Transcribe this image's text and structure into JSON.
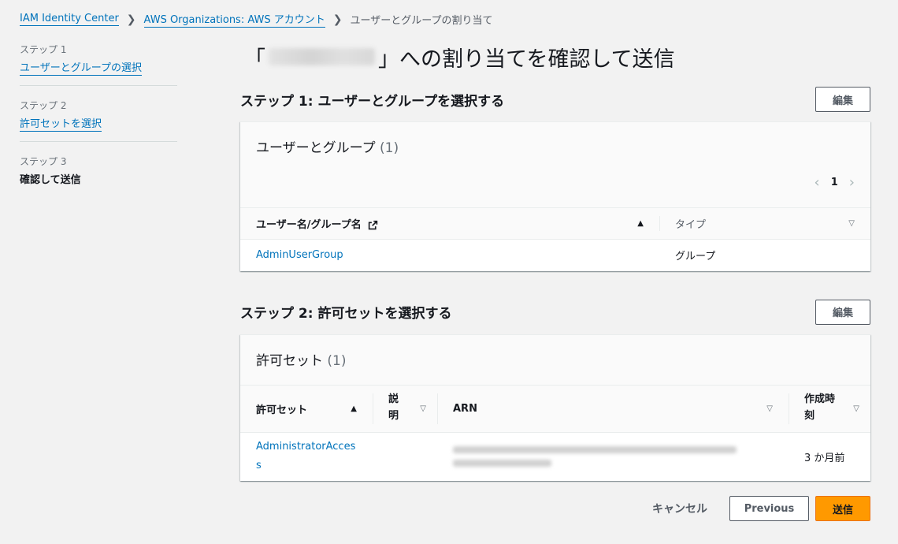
{
  "breadcrumb": {
    "items": [
      {
        "label": "IAM Identity Center",
        "link": true
      },
      {
        "label": "AWS Organizations: AWS アカウント",
        "link": true
      },
      {
        "label": "ユーザーとグループの割り当て",
        "link": false
      }
    ],
    "separator_icon": "chevron-right-icon"
  },
  "steps": [
    {
      "number": "ステップ 1",
      "label": "ユーザーとグループの選択",
      "link": true
    },
    {
      "number": "ステップ 2",
      "label": "許可セットを選択",
      "link": true
    },
    {
      "number": "ステップ 3",
      "label": "確認して送信",
      "link": false,
      "active": true
    }
  ],
  "page": {
    "title_open": "「",
    "title_account_redacted": "[redacted account name]",
    "title_close": "」への割り当てを確認して送信"
  },
  "section1": {
    "title": "ステップ 1: ユーザーとグループを選択する",
    "edit_label": "編集",
    "card_title": "ユーザーとグループ",
    "card_count": "(1)",
    "pager": {
      "current_page": "1",
      "prev_icon": "chevron-left-icon",
      "next_icon": "chevron-right-icon"
    },
    "columns": [
      {
        "label": "ユーザー名/グループ名",
        "icon": "external-link-icon",
        "sort": "ascending"
      },
      {
        "label": "タイプ",
        "sort": "none"
      }
    ],
    "rows": [
      {
        "name": "AdminUserGroup",
        "type": "グループ"
      }
    ]
  },
  "section2": {
    "title": "ステップ 2: 許可セットを選択する",
    "edit_label": "編集",
    "card_title": "許可セット",
    "card_count": "(1)",
    "columns": [
      {
        "label": "許可セット",
        "sort": "ascending"
      },
      {
        "label": "説明",
        "sort": "none"
      },
      {
        "label": "ARN",
        "sort": "none"
      },
      {
        "label": "作成時刻",
        "sort": "none"
      }
    ],
    "rows": [
      {
        "name": "AdministratorAccess",
        "description": "",
        "arn": "[redacted ARN]",
        "created": "3 か月前"
      }
    ]
  },
  "footer": {
    "cancel_label": "キャンセル",
    "previous_label": "Previous",
    "submit_label": "送信",
    "submit_color": "#ff9900"
  }
}
